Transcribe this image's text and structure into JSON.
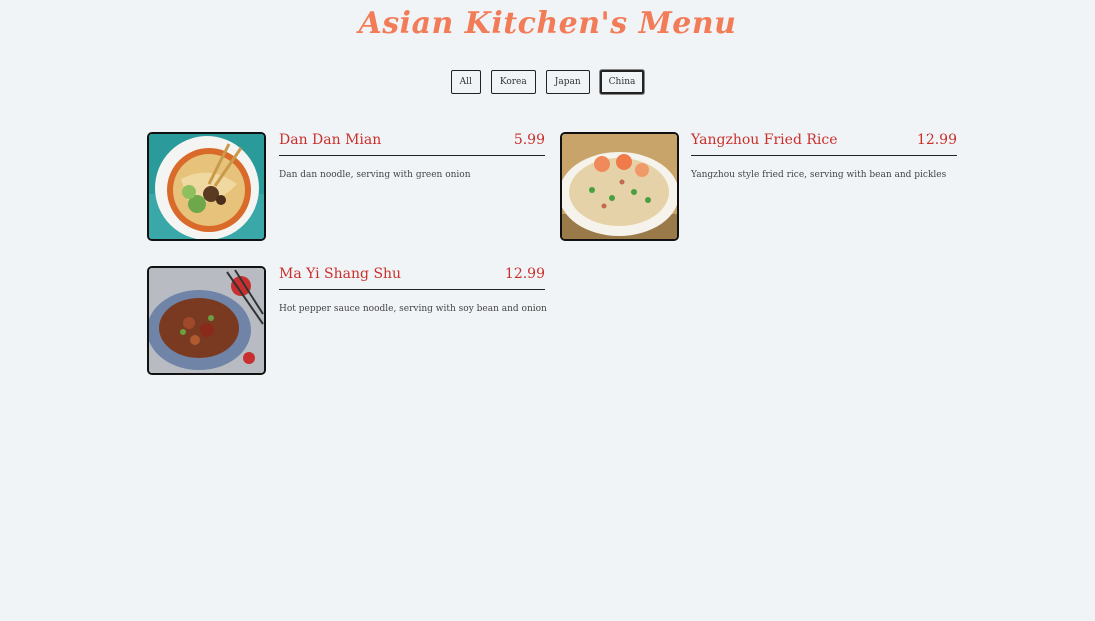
{
  "title": "Asian Kitchen's Menu",
  "filters": [
    {
      "label": "All",
      "active": false
    },
    {
      "label": "Korea",
      "active": false
    },
    {
      "label": "Japan",
      "active": false
    },
    {
      "label": "China",
      "active": true
    }
  ],
  "items": [
    {
      "name": "Dan Dan Mian",
      "price": "5.99",
      "description": "Dan dan noodle, serving with green onion"
    },
    {
      "name": "Yangzhou Fried Rice",
      "price": "12.99",
      "description": "Yangzhou style fried rice, serving with bean and pickles"
    },
    {
      "name": "Ma Yi Shang Shu",
      "price": "12.99",
      "description": "Hot pepper sauce noodle, serving with soy bean and onion"
    }
  ],
  "colors": {
    "title": "#f27c57",
    "dish": "#c9302c",
    "background": "#f1f4f7"
  }
}
